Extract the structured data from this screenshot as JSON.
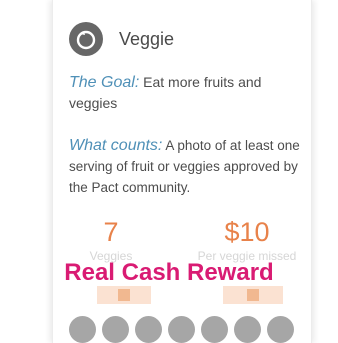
{
  "pact": {
    "title": "Veggie",
    "icon": "pact-ring-icon"
  },
  "goal": {
    "label": "The Goal:",
    "text": " Eat more fruits and veggies"
  },
  "counts": {
    "label": "What counts:",
    "text": " A photo of at least one serving of fruit or veggies approved by the Pact community."
  },
  "stats": [
    {
      "value": "7",
      "label": "Veggies"
    },
    {
      "value": "$10",
      "label": "Per veggie missed"
    }
  ],
  "overlay": {
    "text": "Real Cash Reward"
  },
  "pager": {
    "dot_count": 7
  },
  "colors": {
    "accent_blue": "#4f90b7",
    "accent_orange": "#e8824a",
    "overlay_pink": "#d91b73"
  }
}
